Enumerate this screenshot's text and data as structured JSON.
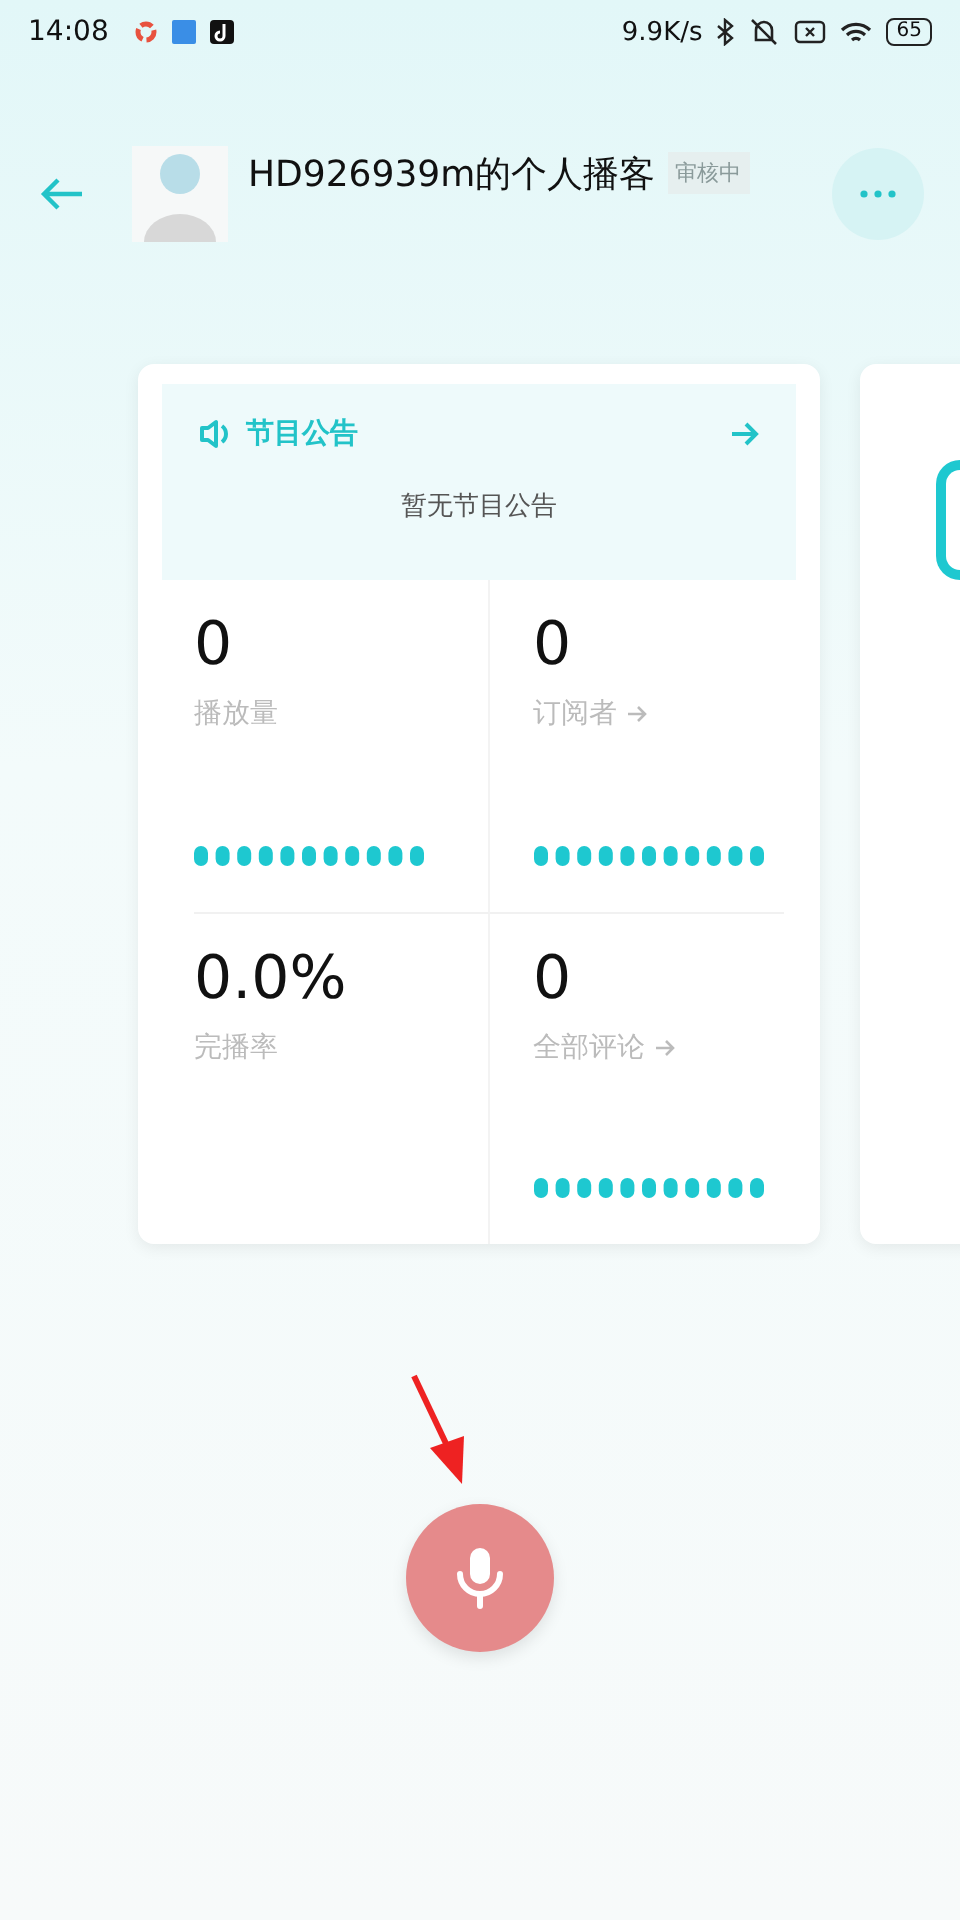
{
  "status_bar": {
    "time": "14:08",
    "speed": "9.9K/s",
    "battery": "65"
  },
  "header": {
    "title": "HD926939m的个人播客",
    "badge": "审核中"
  },
  "notice": {
    "title": "节目公告",
    "body": "暂无节目公告"
  },
  "stats": [
    {
      "value": "0",
      "label": "播放量",
      "link": false,
      "kind": "trend"
    },
    {
      "value": "0",
      "label": "订阅者",
      "link": true,
      "kind": "trend"
    },
    {
      "value": "0.0%",
      "label": "完播率",
      "link": false,
      "kind": "plain"
    },
    {
      "value": "0",
      "label": "全部评论",
      "link": true,
      "kind": "trend"
    }
  ]
}
